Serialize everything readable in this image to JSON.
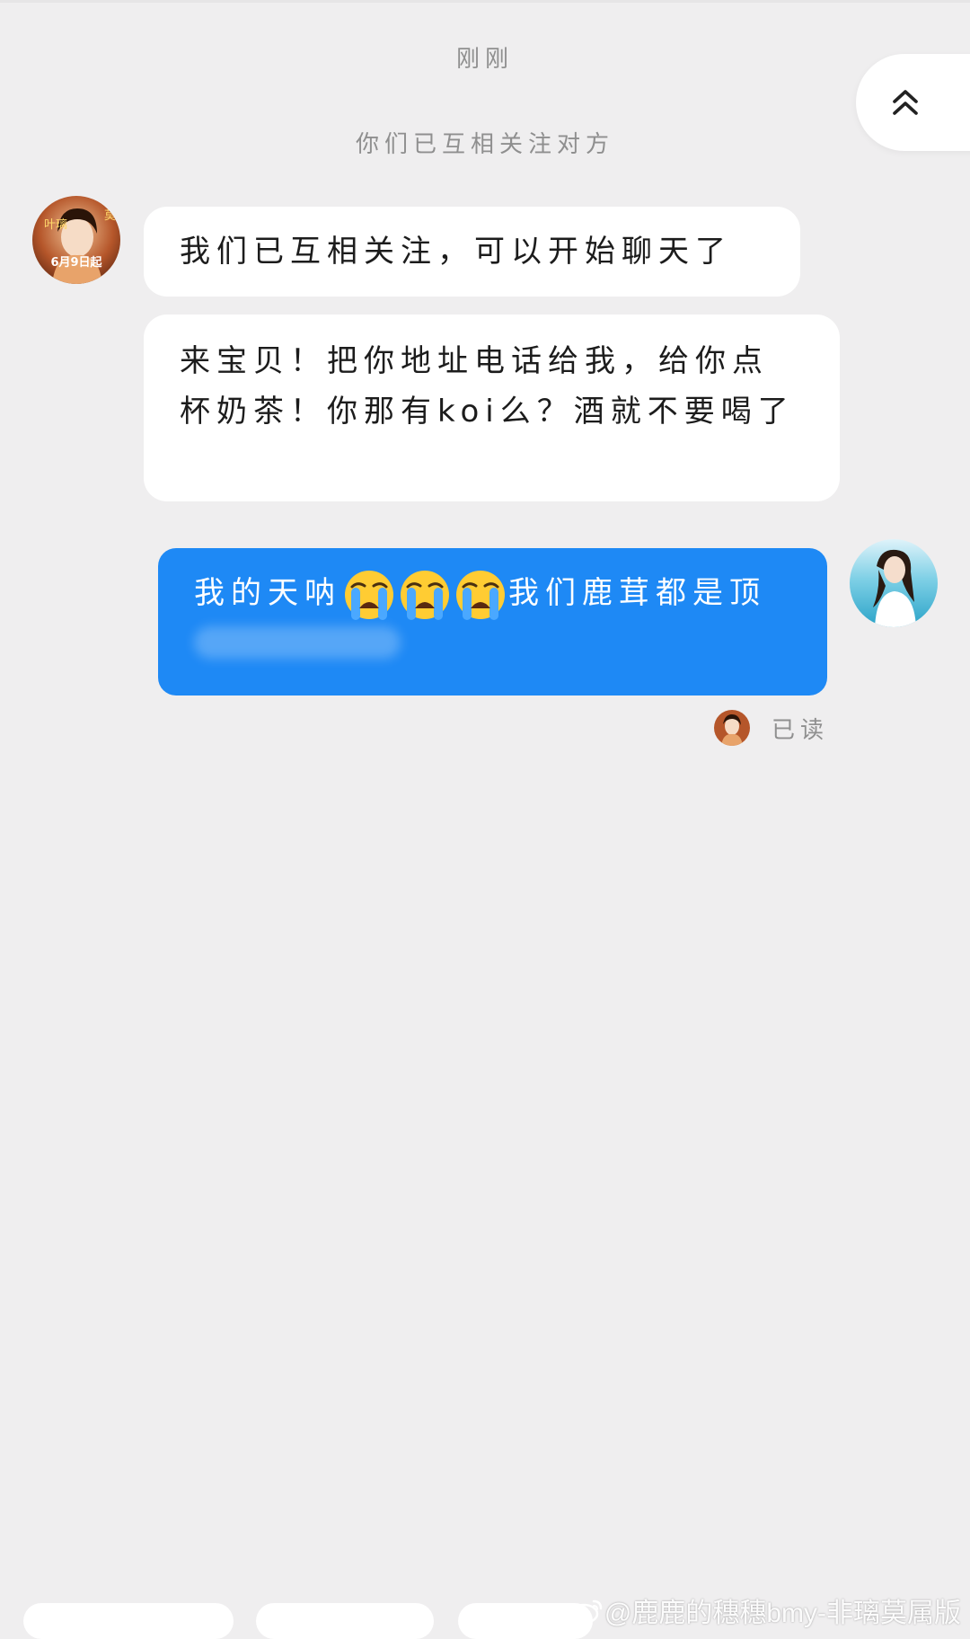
{
  "chat": {
    "time_label": "刚刚",
    "system_message": "你们已互相关注对方",
    "messages": [
      {
        "text": "我们已互相关注，可以开始聊天了"
      },
      {
        "text": "来宝贝！把你地址电话给我，给你点杯奶茶！你那有koi么？酒就不要喝了"
      },
      {
        "text_before": "我的天呐",
        "emoji": "loudly-crying-face",
        "emoji_count": 3,
        "text_after": "我们鹿茸都是顶"
      }
    ],
    "read_status": "已读"
  },
  "avatars": {
    "other_poster_text_1": "叶璃",
    "other_poster_text_2": "莫",
    "other_poster_text_3": "6月9日起"
  },
  "watermark": {
    "text": "@鹿鹿的穗穗bmy-非璃莫属版",
    "icon": "weibo-logo"
  },
  "colors": {
    "background": "#efeeef",
    "bubble_out": "#1e89f5",
    "bubble_in": "#ffffff",
    "muted_text": "#8f8f8f"
  }
}
